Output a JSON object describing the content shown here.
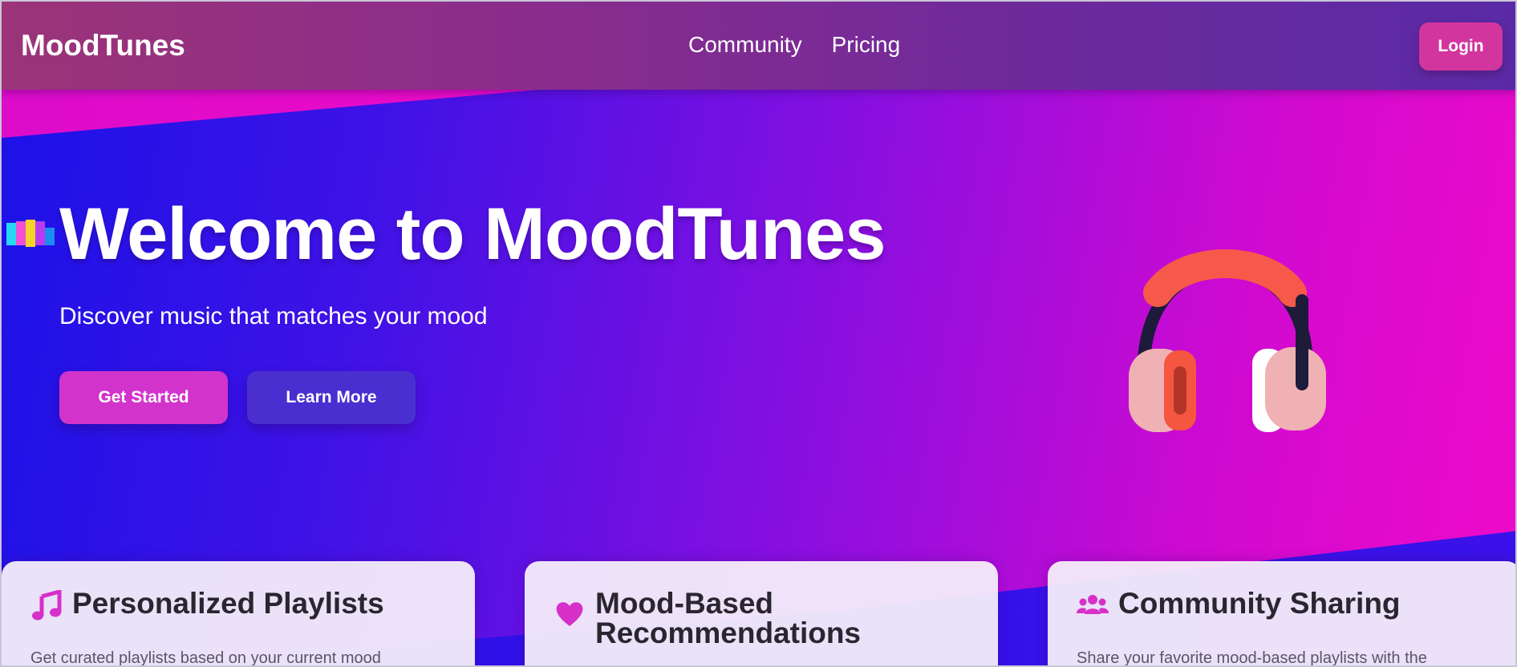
{
  "colors": {
    "accent_pink": "#d234cb",
    "button_indigo": "#4a2fd0",
    "login_button": "#d2359e",
    "icon_magenta": "#d630c9"
  },
  "nav": {
    "logo": "MoodTunes",
    "links": [
      "Community",
      "Pricing"
    ],
    "login_label": "Login"
  },
  "hero": {
    "title": "Welcome to MoodTunes",
    "subtitle": "Discover music that matches your mood",
    "primary_button": "Get Started",
    "secondary_button": "Learn More",
    "illustration": "headphones-icon"
  },
  "features": [
    {
      "icon": "music-note-icon",
      "title": "Personalized Playlists",
      "text": "Get curated playlists based on your current mood"
    },
    {
      "icon": "heart-icon",
      "title": "Mood-Based Recommendations",
      "text": ""
    },
    {
      "icon": "users-icon",
      "title": "Community Sharing",
      "text": "Share your favorite mood-based playlists with the"
    }
  ]
}
